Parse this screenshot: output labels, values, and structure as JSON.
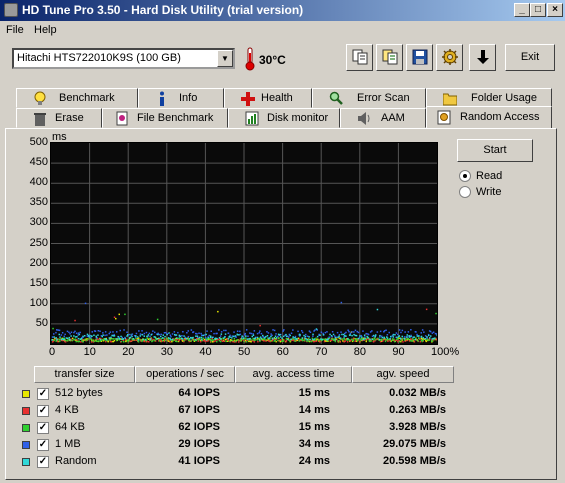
{
  "window": {
    "title": "HD Tune Pro 3.50 - Hard Disk Utility (trial version)",
    "minimize": "_",
    "maximize": "□",
    "close": "×"
  },
  "menu": {
    "file": "File",
    "help": "Help"
  },
  "toolbar": {
    "drive": "Hitachi HTS722010K9S (100 GB)",
    "temperature": "30°C",
    "exit_label": "Exit",
    "buttons": [
      "copy-icon",
      "copy-all-icon",
      "save-icon",
      "options-icon",
      "download-icon"
    ]
  },
  "tabs_row1": [
    "Benchmark",
    "Info",
    "Health",
    "Error Scan",
    "Folder Usage"
  ],
  "tabs_row2": [
    "Erase",
    "File Benchmark",
    "Disk monitor",
    "AAM",
    "Random Access"
  ],
  "active_tab": "Random Access",
  "controls": {
    "start_label": "Start",
    "read_label": "Read",
    "write_label": "Write",
    "selected_mode": "Read"
  },
  "chart_data": {
    "type": "scatter",
    "y_unit": "ms",
    "yticks": [
      "500",
      "450",
      "400",
      "350",
      "300",
      "250",
      "200",
      "150",
      "100",
      "50"
    ],
    "xticks": [
      "0",
      "10",
      "20",
      "30",
      "40",
      "50",
      "60",
      "70",
      "80",
      "90",
      "100%"
    ],
    "ylim": [
      0,
      500
    ],
    "xlim": [
      0,
      100
    ],
    "grid": true,
    "background": "#0a0a0a",
    "series": [
      {
        "name": "512 bytes",
        "color": "#e8e800",
        "mean_ms": 15
      },
      {
        "name": "4 KB",
        "color": "#e83030",
        "mean_ms": 14
      },
      {
        "name": "64 KB",
        "color": "#30d030",
        "mean_ms": 15
      },
      {
        "name": "1 MB",
        "color": "#3060e8",
        "mean_ms": 34
      },
      {
        "name": "Random",
        "color": "#30d8d8",
        "mean_ms": 24
      }
    ]
  },
  "results": {
    "headers": [
      "transfer size",
      "operations / sec",
      "avg. access time",
      "agv. speed"
    ],
    "rows": [
      {
        "size": "512 bytes",
        "ops": "64 IOPS",
        "access": "15 ms",
        "speed": "0.032 MB/s",
        "color": "#e8e800"
      },
      {
        "size": "4 KB",
        "ops": "67 IOPS",
        "access": "14 ms",
        "speed": "0.263 MB/s",
        "color": "#e83030"
      },
      {
        "size": "64 KB",
        "ops": "62 IOPS",
        "access": "15 ms",
        "speed": "3.928 MB/s",
        "color": "#30d030"
      },
      {
        "size": "1 MB",
        "ops": "29 IOPS",
        "access": "34 ms",
        "speed": "29.075 MB/s",
        "color": "#3060e8"
      },
      {
        "size": "Random",
        "ops": "41 IOPS",
        "access": "24 ms",
        "speed": "20.598 MB/s",
        "color": "#30d8d8"
      }
    ]
  }
}
